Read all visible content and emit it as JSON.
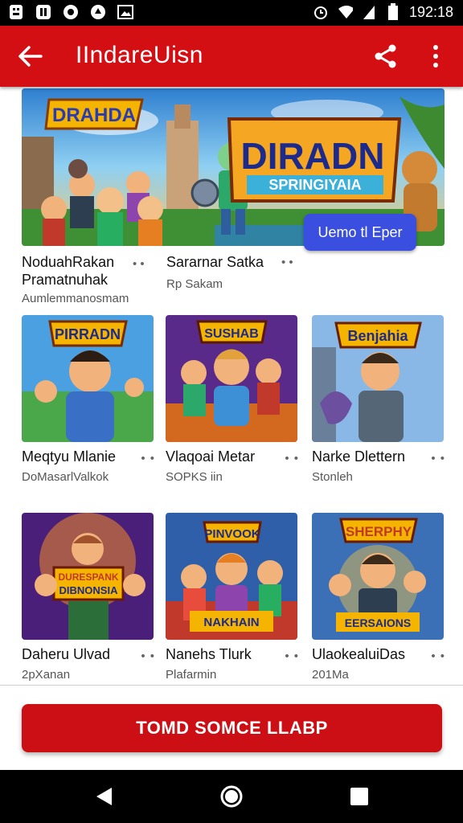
{
  "status_bar": {
    "time": "192:18",
    "icons": [
      "notification-icon",
      "whatsapp-icon",
      "music-icon",
      "gallery-icon",
      "alarm-icon",
      "wifi-icon",
      "signal-icon",
      "battery-icon"
    ]
  },
  "app_bar": {
    "title": "IIndareUisn",
    "back_icon": "arrow-back-icon",
    "share_icon": "share-icon",
    "more_icon": "more-vert-icon"
  },
  "hero": {
    "button_label": "Uemo tl Eper",
    "caption_left": {
      "title": "NoduahRakan",
      "line2": "Pramatnuhak",
      "sub": "Aumlemmanosmam"
    },
    "caption_right": {
      "title": "Sararnar Satka",
      "sub": "Rp Sakam"
    }
  },
  "cards": [
    {
      "title": "Meqtyu Mlanie",
      "sub": "DoMasarlValkok"
    },
    {
      "title": "Vlaqoai Metar",
      "sub": "SOPKS iin"
    },
    {
      "title": "Narke Dlettern",
      "sub": "Stonleh"
    },
    {
      "title": "Daheru Ulvad",
      "sub": "2pXanan"
    },
    {
      "title": "Nanehs Tlurk",
      "sub": "Plafarmin"
    },
    {
      "title": "UlaokealuiDas",
      "sub": "201Ma"
    }
  ],
  "cta_label": "TOMD SOMCE LLABP",
  "nav_bar": {
    "back": "back-triangle-icon",
    "home": "home-circle-icon",
    "recents": "recents-square-icon"
  },
  "colors": {
    "accent": "#d40f14",
    "hero_button": "#3a4fe0"
  }
}
